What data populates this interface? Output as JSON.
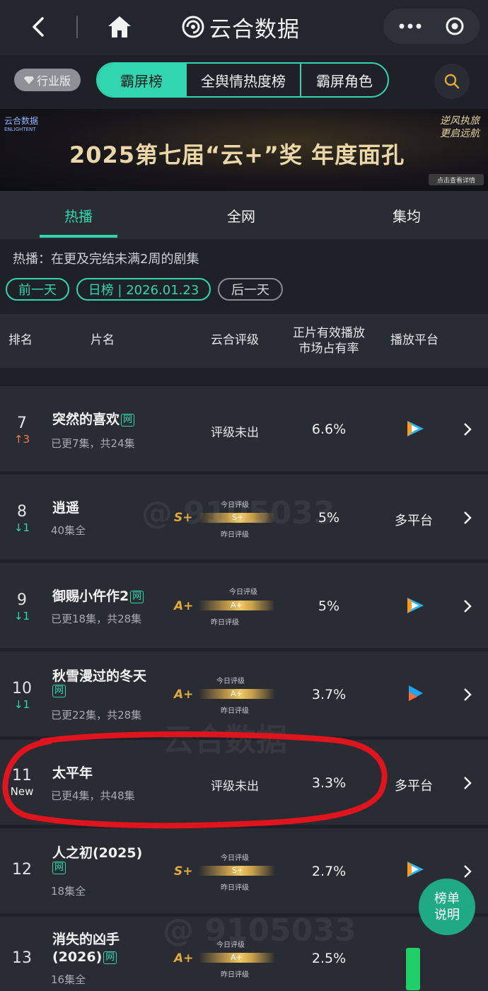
{
  "header": {
    "brand": "云合数据",
    "icons": [
      "back-icon",
      "home-icon",
      "more-icon",
      "target-icon"
    ]
  },
  "segment": {
    "industry": "行业版",
    "tabs": [
      "霸屏榜",
      "全舆情热度榜",
      "霸屏角色"
    ],
    "active": 0
  },
  "banner": {
    "logo": "云合数据",
    "logo_sub": "ENLIGHTENT",
    "title": "2025第七届“云+”奖  年度面孔",
    "slogan": "逆风执旅 更启远航",
    "cta": "点击查看详情"
  },
  "tabs": [
    "热播",
    "全网",
    "集均"
  ],
  "note": "热播：在更及完结未满2周的剧集",
  "date_nav": {
    "prev": "前一天",
    "current": "日榜 | 2026.01.23",
    "next": "后一天"
  },
  "columns": {
    "rank": "排名",
    "name": "片名",
    "rating": "云合评级",
    "share_l1": "正片有效播放",
    "share_l2": "市场占有率",
    "platform": "播放平台"
  },
  "rows": [
    {
      "rank": "7",
      "trend": "↑3",
      "title": "突然的喜欢",
      "tag": "网",
      "episodes": "已更7集，共24集",
      "rating": "评级未出",
      "share": "6.6%",
      "platform": "tencent-video-icon"
    },
    {
      "rank": "8",
      "trend": "↓1",
      "title": "逍遥",
      "tag": "",
      "episodes": "40集全",
      "grade": "S+",
      "bar_grade": "S+",
      "today": "今日评级",
      "yesterday": "昨日评级",
      "share": "5%",
      "platform": "多平台"
    },
    {
      "rank": "9",
      "trend": "↓1",
      "title": "御赐小仵作2",
      "tag": "网",
      "episodes": "已更18集，共28集",
      "grade": "A+",
      "bar_grade": "A+",
      "today": "今日评级",
      "yesterday": "昨日评级",
      "share": "5%",
      "platform": "tencent-video-icon"
    },
    {
      "rank": "10",
      "trend": "↓1",
      "title": "秋雪漫过的冬天",
      "tag": "网",
      "episodes": "已更22集，共28集",
      "grade": "A+",
      "bar_grade": "A+",
      "today": "今日评级",
      "yesterday": "昨日评级",
      "share": "3.7%",
      "platform": "youku-icon"
    },
    {
      "rank": "11",
      "trend": "New",
      "title": "太平年",
      "tag": "",
      "episodes": "已更4集，共48集",
      "rating": "评级未出",
      "share": "3.3%",
      "platform": "多平台"
    },
    {
      "rank": "12",
      "trend": "",
      "title": "人之初(2025)",
      "tag": "网",
      "episodes": "18集全",
      "grade": "S+",
      "bar_grade": "S+",
      "today": "今日评级",
      "yesterday": "昨日评级",
      "share": "2.7%",
      "platform": "tencent-video-icon"
    },
    {
      "rank": "13",
      "trend": "",
      "title": "消失的凶手(2026)",
      "tag": "网",
      "episodes": "16集全",
      "grade": "A+",
      "bar_grade": "A+",
      "today": "今日评级",
      "yesterday": "昨日评级",
      "share": "2.5%",
      "platform": "iqiyi-icon"
    }
  ],
  "fab": {
    "line1": "榜单",
    "line2": "说明"
  },
  "watermarks": [
    "@ 9105033",
    "云合数据",
    "@ 9105033"
  ],
  "colors": {
    "accent": "#31d6b0",
    "gold": "#e1ab3a",
    "annotation": "#e0141c"
  }
}
